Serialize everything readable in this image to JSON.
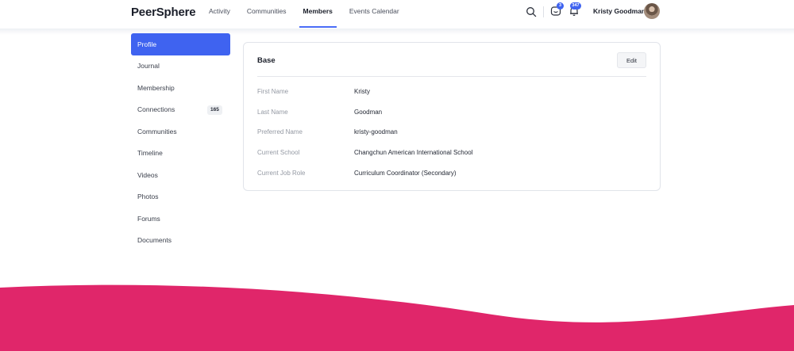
{
  "header": {
    "logo": "PeerSphere",
    "nav": [
      "Activity",
      "Communities",
      "Members",
      "Events Calendar"
    ],
    "active_nav": "Members",
    "messages_count": "3",
    "notifications_count": "347",
    "user_name": "Kristy Goodman"
  },
  "sidebar": {
    "items": [
      {
        "label": "Profile"
      },
      {
        "label": "Journal"
      },
      {
        "label": "Membership"
      },
      {
        "label": "Connections",
        "count": "165"
      },
      {
        "label": "Communities"
      },
      {
        "label": "Timeline"
      },
      {
        "label": "Videos"
      },
      {
        "label": "Photos"
      },
      {
        "label": "Forums"
      },
      {
        "label": "Documents"
      }
    ]
  },
  "profile": {
    "section_title": "Base",
    "edit_label": "Edit",
    "fields": [
      {
        "label": "First Name",
        "value": "Kristy"
      },
      {
        "label": "Last Name",
        "value": "Goodman"
      },
      {
        "label": "Preferred Name",
        "value": "kristy-goodman"
      },
      {
        "label": "Current School",
        "value": "Changchun American International School"
      },
      {
        "label": "Current Job Role",
        "value": "Curriculum Coordinator (Secondary)"
      }
    ]
  },
  "colors": {
    "accent": "#3f63f0",
    "wave": "#e0266a"
  },
  "icons": [
    "search-icon",
    "message-icon",
    "bell-icon"
  ]
}
